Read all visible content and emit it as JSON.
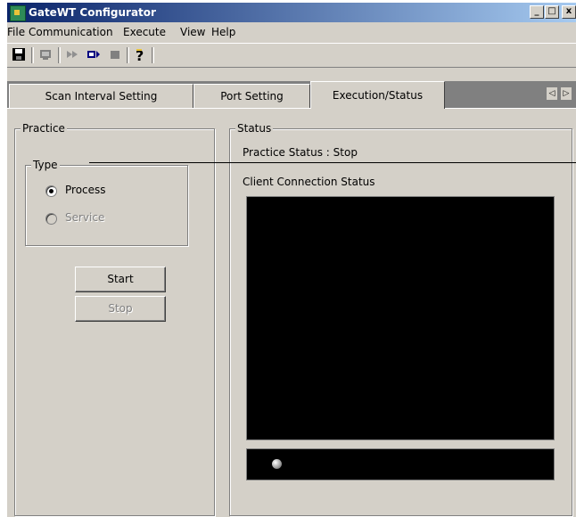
{
  "window": {
    "title": "GateWT Configurator"
  },
  "title_buttons": {
    "minimize": "_",
    "maximize": "□",
    "close": "x"
  },
  "menu": [
    "File",
    "Communication",
    "Execute",
    "View",
    "Help"
  ],
  "toolbar_icons": [
    "save-icon",
    "connect-icon",
    "run-icon",
    "next-icon",
    "stop-icon",
    "help-icon"
  ],
  "tabs": [
    "Scan Interval Setting",
    "Port Setting",
    "Execution/Status"
  ],
  "tab_scroll": {
    "left": "◁",
    "right": "▷"
  },
  "practice": {
    "group_label": "Practice",
    "type_label": "Type",
    "options": [
      "Process",
      "Service"
    ],
    "selected": "Process",
    "start_label": "Start",
    "stop_label": "Stop"
  },
  "status": {
    "group_label": "Status",
    "practice_status": "Practice Status : Stop",
    "client_connection": "Client Connection Status"
  }
}
